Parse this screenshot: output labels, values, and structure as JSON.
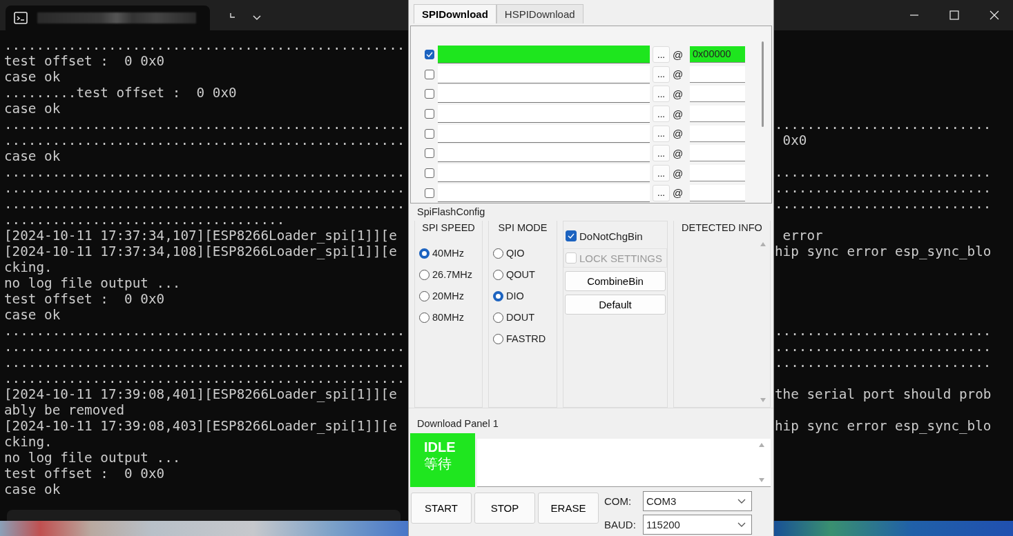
{
  "terminal": {
    "lines": [
      {
        "left": ".................................................."
      },
      {
        "left": "test offset :  0 0x0"
      },
      {
        "left": "case ok"
      },
      {
        "left": ".........test offset :  0 0x0"
      },
      {
        "left": "case ok"
      },
      {
        "left": "..................................................",
        "right": "..........................."
      },
      {
        "left": "..................................................",
        "right": " 0x0"
      },
      {
        "left": "case ok"
      },
      {
        "left": "..................................................",
        "right": "..........................."
      },
      {
        "left": "..................................................",
        "right": "..........................."
      },
      {
        "left": "..................................................",
        "right": "..........................."
      },
      {
        "left": "..................................."
      },
      {
        "left": "[2024-10-11 17:37:34,107][ESP8266Loader_spi[1]][e",
        "right": " error"
      },
      {
        "left": "[2024-10-11 17:37:34,108][ESP8266Loader_spi[1]][e",
        "right": "hip sync error esp_sync_blo"
      },
      {
        "left": "cking."
      },
      {
        "left": "no log file output ..."
      },
      {
        "left": "test offset :  0 0x0"
      },
      {
        "left": "case ok"
      },
      {
        "left": "..................................................",
        "right": "..........................."
      },
      {
        "left": "..................................................",
        "right": "..........................."
      },
      {
        "left": "..................................................",
        "right": "..........................."
      },
      {
        "left": ".................................................."
      },
      {
        "left": "[2024-10-11 17:39:08,401][ESP8266Loader_spi[1]][e",
        "right": "the serial port should prob"
      },
      {
        "left": "ably be removed"
      },
      {
        "left": "[2024-10-11 17:39:08,403][ESP8266Loader_spi[1]][e",
        "right": "hip sync error esp_sync_blo"
      },
      {
        "left": "cking."
      },
      {
        "left": "no log file output ..."
      },
      {
        "left": "test offset :  0 0x0"
      },
      {
        "left": "case ok"
      }
    ]
  },
  "flash_tool": {
    "tabs": [
      {
        "label": "SPIDownload",
        "selected": true
      },
      {
        "label": "HSPIDownload",
        "selected": false
      }
    ],
    "files": [
      {
        "checked": true,
        "highlighted": true,
        "browse": "...",
        "at": "@",
        "address": "0x00000"
      },
      {
        "checked": false,
        "highlighted": false,
        "browse": "...",
        "at": "@"
      },
      {
        "checked": false,
        "highlighted": false,
        "browse": "...",
        "at": "@"
      },
      {
        "checked": false,
        "highlighted": false,
        "browse": "...",
        "at": "@"
      },
      {
        "checked": false,
        "highlighted": false,
        "browse": "...",
        "at": "@"
      },
      {
        "checked": false,
        "highlighted": false,
        "browse": "...",
        "at": "@"
      },
      {
        "checked": false,
        "highlighted": false,
        "browse": "...",
        "at": "@"
      },
      {
        "checked": false,
        "highlighted": false,
        "browse": "...",
        "at": "@"
      }
    ],
    "config": {
      "title": "SpiFlashConfig",
      "speed": {
        "title": "SPI SPEED",
        "options": [
          {
            "label": "40MHz",
            "selected": true
          },
          {
            "label": "26.7MHz",
            "selected": false
          },
          {
            "label": "20MHz",
            "selected": false
          },
          {
            "label": "80MHz",
            "selected": false
          }
        ]
      },
      "mode": {
        "title": "SPI MODE",
        "options": [
          {
            "label": "QIO",
            "selected": false
          },
          {
            "label": "QOUT",
            "selected": false
          },
          {
            "label": "DIO",
            "selected": true
          },
          {
            "label": "DOUT",
            "selected": false
          },
          {
            "label": "FASTRD",
            "selected": false
          }
        ]
      },
      "checks": [
        {
          "label": "DoNotChgBin",
          "checked": true,
          "disabled": false
        },
        {
          "label": "LOCK SETTINGS",
          "checked": false,
          "disabled": true
        }
      ],
      "buttons": [
        "CombineBin",
        "Default"
      ],
      "detected_info": {
        "title": "DETECTED INFO"
      }
    },
    "download_panel": {
      "title": "Download Panel 1",
      "status": {
        "kind": "idle",
        "text": "IDLE",
        "subtext": "等待"
      },
      "buttons": [
        "START",
        "STOP",
        "ERASE"
      ],
      "com": {
        "label": "COM:",
        "value": "COM3"
      },
      "baud": {
        "label": "BAUD:",
        "value": "115200"
      }
    }
  }
}
